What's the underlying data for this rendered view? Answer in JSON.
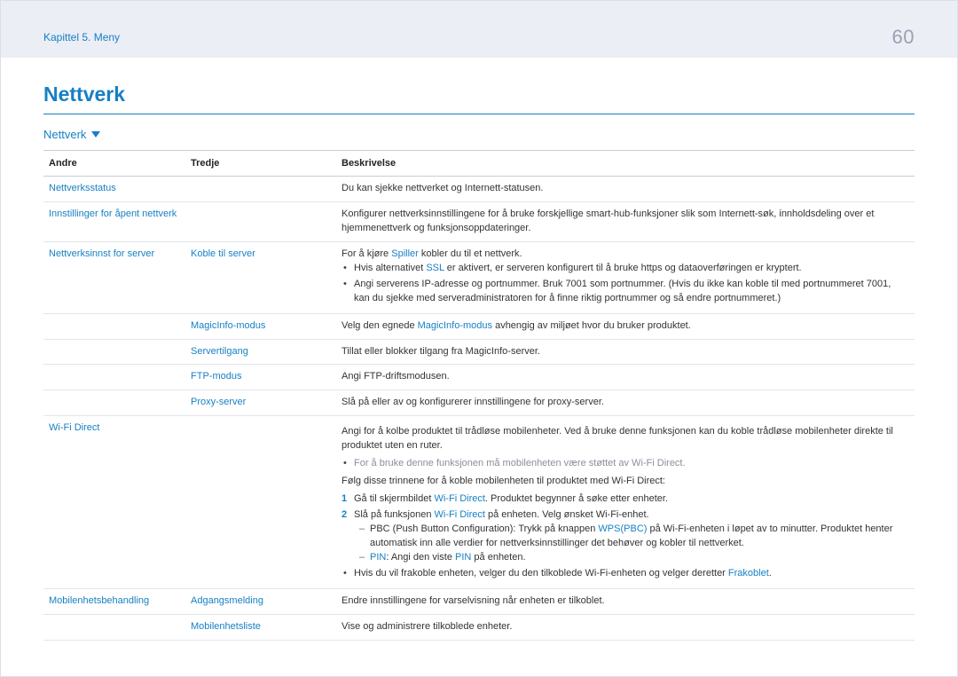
{
  "header": {
    "chapter": "Kapittel 5. Meny",
    "page_number": "60"
  },
  "title": "Nettverk",
  "section_dropdown": "Nettverk",
  "columns": {
    "andre": "Andre",
    "tredje": "Tredje",
    "beskrivelse": "Beskrivelse"
  },
  "rows": {
    "nettverksstatus": {
      "andre": "Nettverksstatus",
      "desc": "Du kan sjekke nettverket og Internett-statusen."
    },
    "innstillinger_apent": {
      "andre": "Innstillinger for åpent nettverk",
      "desc": "Konfigurer nettverksinnstillingene for å bruke forskjellige smart-hub-funksjoner slik som Internett-søk, innholdsdeling over et hjemmenettverk og funksjonsoppdateringer."
    },
    "nettverk_server": {
      "andre": "Nettverksinnst for server",
      "koble": {
        "tredje": "Koble til server",
        "desc_pre": "For å kjøre ",
        "desc_link": "Spiller",
        "desc_post": " kobler du til et nettverk.",
        "b1_pre": "Hvis alternativet ",
        "b1_link": "SSL",
        "b1_post": " er aktivert, er serveren konfigurert til å bruke https og dataoverføringen er kryptert.",
        "b2": "Angi serverens IP-adresse og portnummer. Bruk 7001 som portnummer. (Hvis du ikke kan koble til med portnummeret 7001, kan du sjekke med serveradministratoren for å finne riktig portnummer og så endre portnummeret.)"
      },
      "magicinfo": {
        "tredje": "MagicInfo-modus",
        "desc_pre": "Velg den egnede ",
        "desc_link": "MagicInfo-modus",
        "desc_post": " avhengig av miljøet hvor du bruker produktet."
      },
      "servertilgang": {
        "tredje": "Servertilgang",
        "desc": "Tillat eller blokker tilgang fra MagicInfo-server."
      },
      "ftp": {
        "tredje": "FTP-modus",
        "desc": "Angi FTP-driftsmodusen."
      },
      "proxy": {
        "tredje": "Proxy-server",
        "desc": "Slå på eller av og konfigurerer innstillingene for proxy-server."
      }
    },
    "wifi_direct": {
      "andre": "Wi-Fi Direct",
      "p1": "Angi for å kolbe produktet til trådløse mobilenheter. Ved å bruke denne funksjonen kan du koble trådløse mobilenheter direkte til produktet uten en ruter.",
      "note": "For å bruke denne funksjonen må mobilenheten være støttet av Wi-Fi Direct.",
      "p2": "Følg disse trinnene for å koble mobilenheten til produktet med Wi-Fi Direct:",
      "s1_pre": "Gå til skjermbildet ",
      "s1_link": "Wi-Fi Direct",
      "s1_post": ". Produktet begynner å søke etter enheter.",
      "s2_pre": "Slå på funksjonen ",
      "s2_link": "Wi-Fi Direct",
      "s2_post": " på enheten. Velg ønsket Wi-Fi-enhet.",
      "pbc_pre": "PBC (Push Button Configuration): Trykk på knappen ",
      "pbc_link": "WPS(PBC)",
      "pbc_post": " på Wi-Fi-enheten i løpet av to minutter. Produktet henter automatisk inn alle verdier for nettverksinnstillinger det behøver og kobler til nettverket.",
      "pin_label": "PIN",
      "pin_pre": ": Angi den viste ",
      "pin_link": "PIN",
      "pin_post": " på enheten.",
      "frakoblet_pre": "Hvis du vil frakoble enheten, velger du den tilkoblede Wi-Fi-enheten og velger deretter ",
      "frakoblet_link": "Frakoblet",
      "frakoblet_post": "."
    },
    "mobilenhet": {
      "andre": "Mobilenhetsbehandling",
      "adgang": {
        "tredje": "Adgangsmelding",
        "desc": "Endre innstillingene for varselvisning når enheten er tilkoblet."
      },
      "liste": {
        "tredje": "Mobilenhetsliste",
        "desc": "Vise og administrere tilkoblede enheter."
      }
    }
  }
}
